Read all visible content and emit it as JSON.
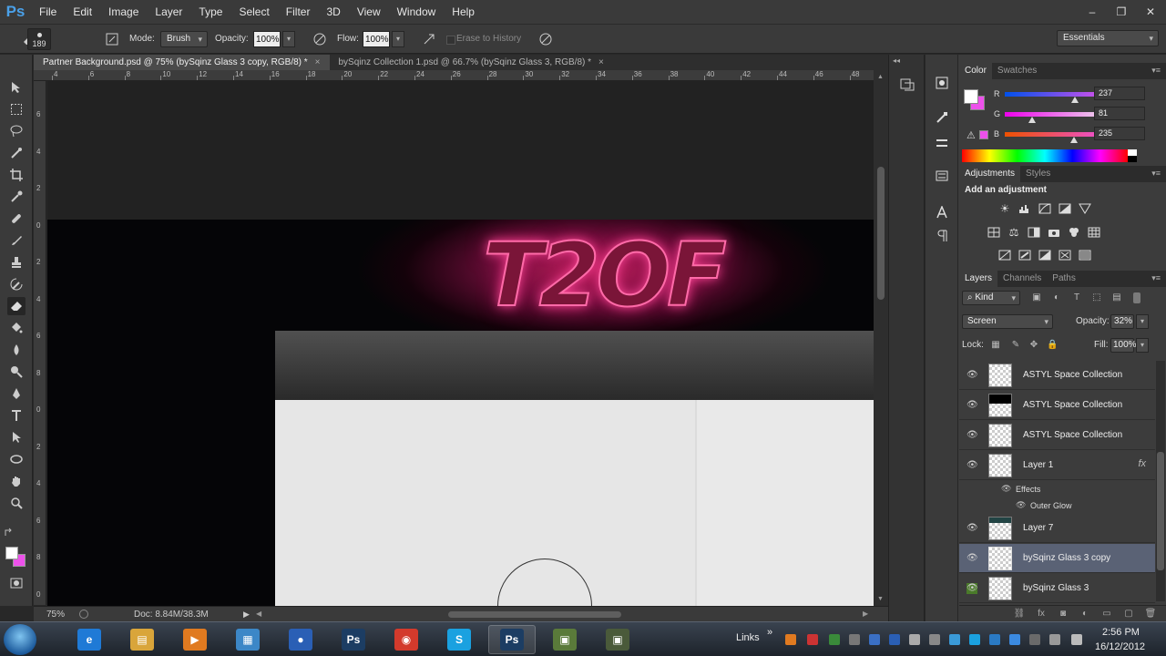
{
  "app": {
    "logo": "Ps"
  },
  "menu": [
    "File",
    "Edit",
    "Image",
    "Layer",
    "Type",
    "Select",
    "Filter",
    "3D",
    "View",
    "Window",
    "Help"
  ],
  "window_controls": {
    "minimize": "–",
    "restore": "❐",
    "close": "✕"
  },
  "options": {
    "brush_size": "189",
    "mode_label": "Mode:",
    "mode_value": "Brush",
    "opacity_label": "Opacity:",
    "opacity_value": "100%",
    "flow_label": "Flow:",
    "flow_value": "100%",
    "erase_history": "Erase to History",
    "workspace": "Essentials"
  },
  "doc_tabs": [
    {
      "label": "Partner Background.psd @ 75% (bySqinz Glass 3 copy, RGB/8) *",
      "close": "×"
    },
    {
      "label": "bySqinz Collection 1.psd @ 66.7% (bySqinz Glass 3, RGB/8) *",
      "close": "×"
    }
  ],
  "ruler_h": [
    "4",
    "6",
    "8",
    "10",
    "12",
    "14",
    "16",
    "18",
    "20",
    "22",
    "24",
    "26",
    "28",
    "30",
    "32",
    "34",
    "36",
    "38",
    "40",
    "42",
    "44",
    "46",
    "48"
  ],
  "ruler_v": [
    "6",
    "4",
    "2",
    "0",
    "2",
    "4",
    "6",
    "8",
    "0",
    "2",
    "4",
    "6",
    "8",
    "0"
  ],
  "status": {
    "zoom": "75%",
    "doc": "Doc: 8.84M/38.3M"
  },
  "canvas": {
    "logo_text": "T2OF"
  },
  "color_panel": {
    "tabs": [
      "Color",
      "Swatches"
    ],
    "channels": [
      {
        "label": "R",
        "value": "237"
      },
      {
        "label": "G",
        "value": "81"
      },
      {
        "label": "B",
        "value": "235"
      }
    ],
    "foreground": "#ffffff",
    "background": "#ed51eb"
  },
  "adjustments_panel": {
    "tabs": [
      "Adjustments",
      "Styles"
    ],
    "title": "Add an adjustment"
  },
  "layers_panel": {
    "tabs": [
      "Layers",
      "Channels",
      "Paths"
    ],
    "kind": "Kind",
    "blend_mode": "Screen",
    "opacity_label": "Opacity:",
    "opacity": "32%",
    "lock_label": "Lock:",
    "fill_label": "Fill:",
    "fill": "100%",
    "layers": [
      {
        "name": "ASTYL Space Collection"
      },
      {
        "name": "ASTYL Space Collection"
      },
      {
        "name": "ASTYL Space Collection"
      },
      {
        "name": "Layer 1",
        "fx": "fx"
      },
      {
        "name": "Layer 7"
      },
      {
        "name": "bySqinz Glass 3 copy",
        "selected": true
      },
      {
        "name": "bySqinz Glass 3"
      }
    ],
    "effects_label": "Effects",
    "outer_glow": "Outer Glow"
  },
  "taskbar": {
    "links": "Links",
    "chevron": "»",
    "time": "2:56 PM",
    "date": "16/12/2012",
    "apps": [
      {
        "name": "internet-explorer",
        "glyph": "e",
        "color": "#1f7ad6"
      },
      {
        "name": "file-explorer",
        "glyph": "▤",
        "color": "#d9a53a"
      },
      {
        "name": "media-player",
        "glyph": "▶",
        "color": "#e07a20"
      },
      {
        "name": "control-panel",
        "glyph": "▦",
        "color": "#3c87c7"
      },
      {
        "name": "globe-app",
        "glyph": "●",
        "color": "#2a5fb5"
      },
      {
        "name": "photoshop-1",
        "glyph": "Ps",
        "color": "#1c3d63"
      },
      {
        "name": "chrome",
        "glyph": "◉",
        "color": "#d33a2c"
      },
      {
        "name": "skype",
        "glyph": "S",
        "color": "#1aa1e0"
      },
      {
        "name": "photoshop-2",
        "glyph": "Ps",
        "color": "#1c3d63",
        "active": true
      },
      {
        "name": "minecraft-1",
        "glyph": "▣",
        "color": "#5a7a3a"
      },
      {
        "name": "minecraft-2",
        "glyph": "▣",
        "color": "#4a5a3a"
      }
    ]
  }
}
